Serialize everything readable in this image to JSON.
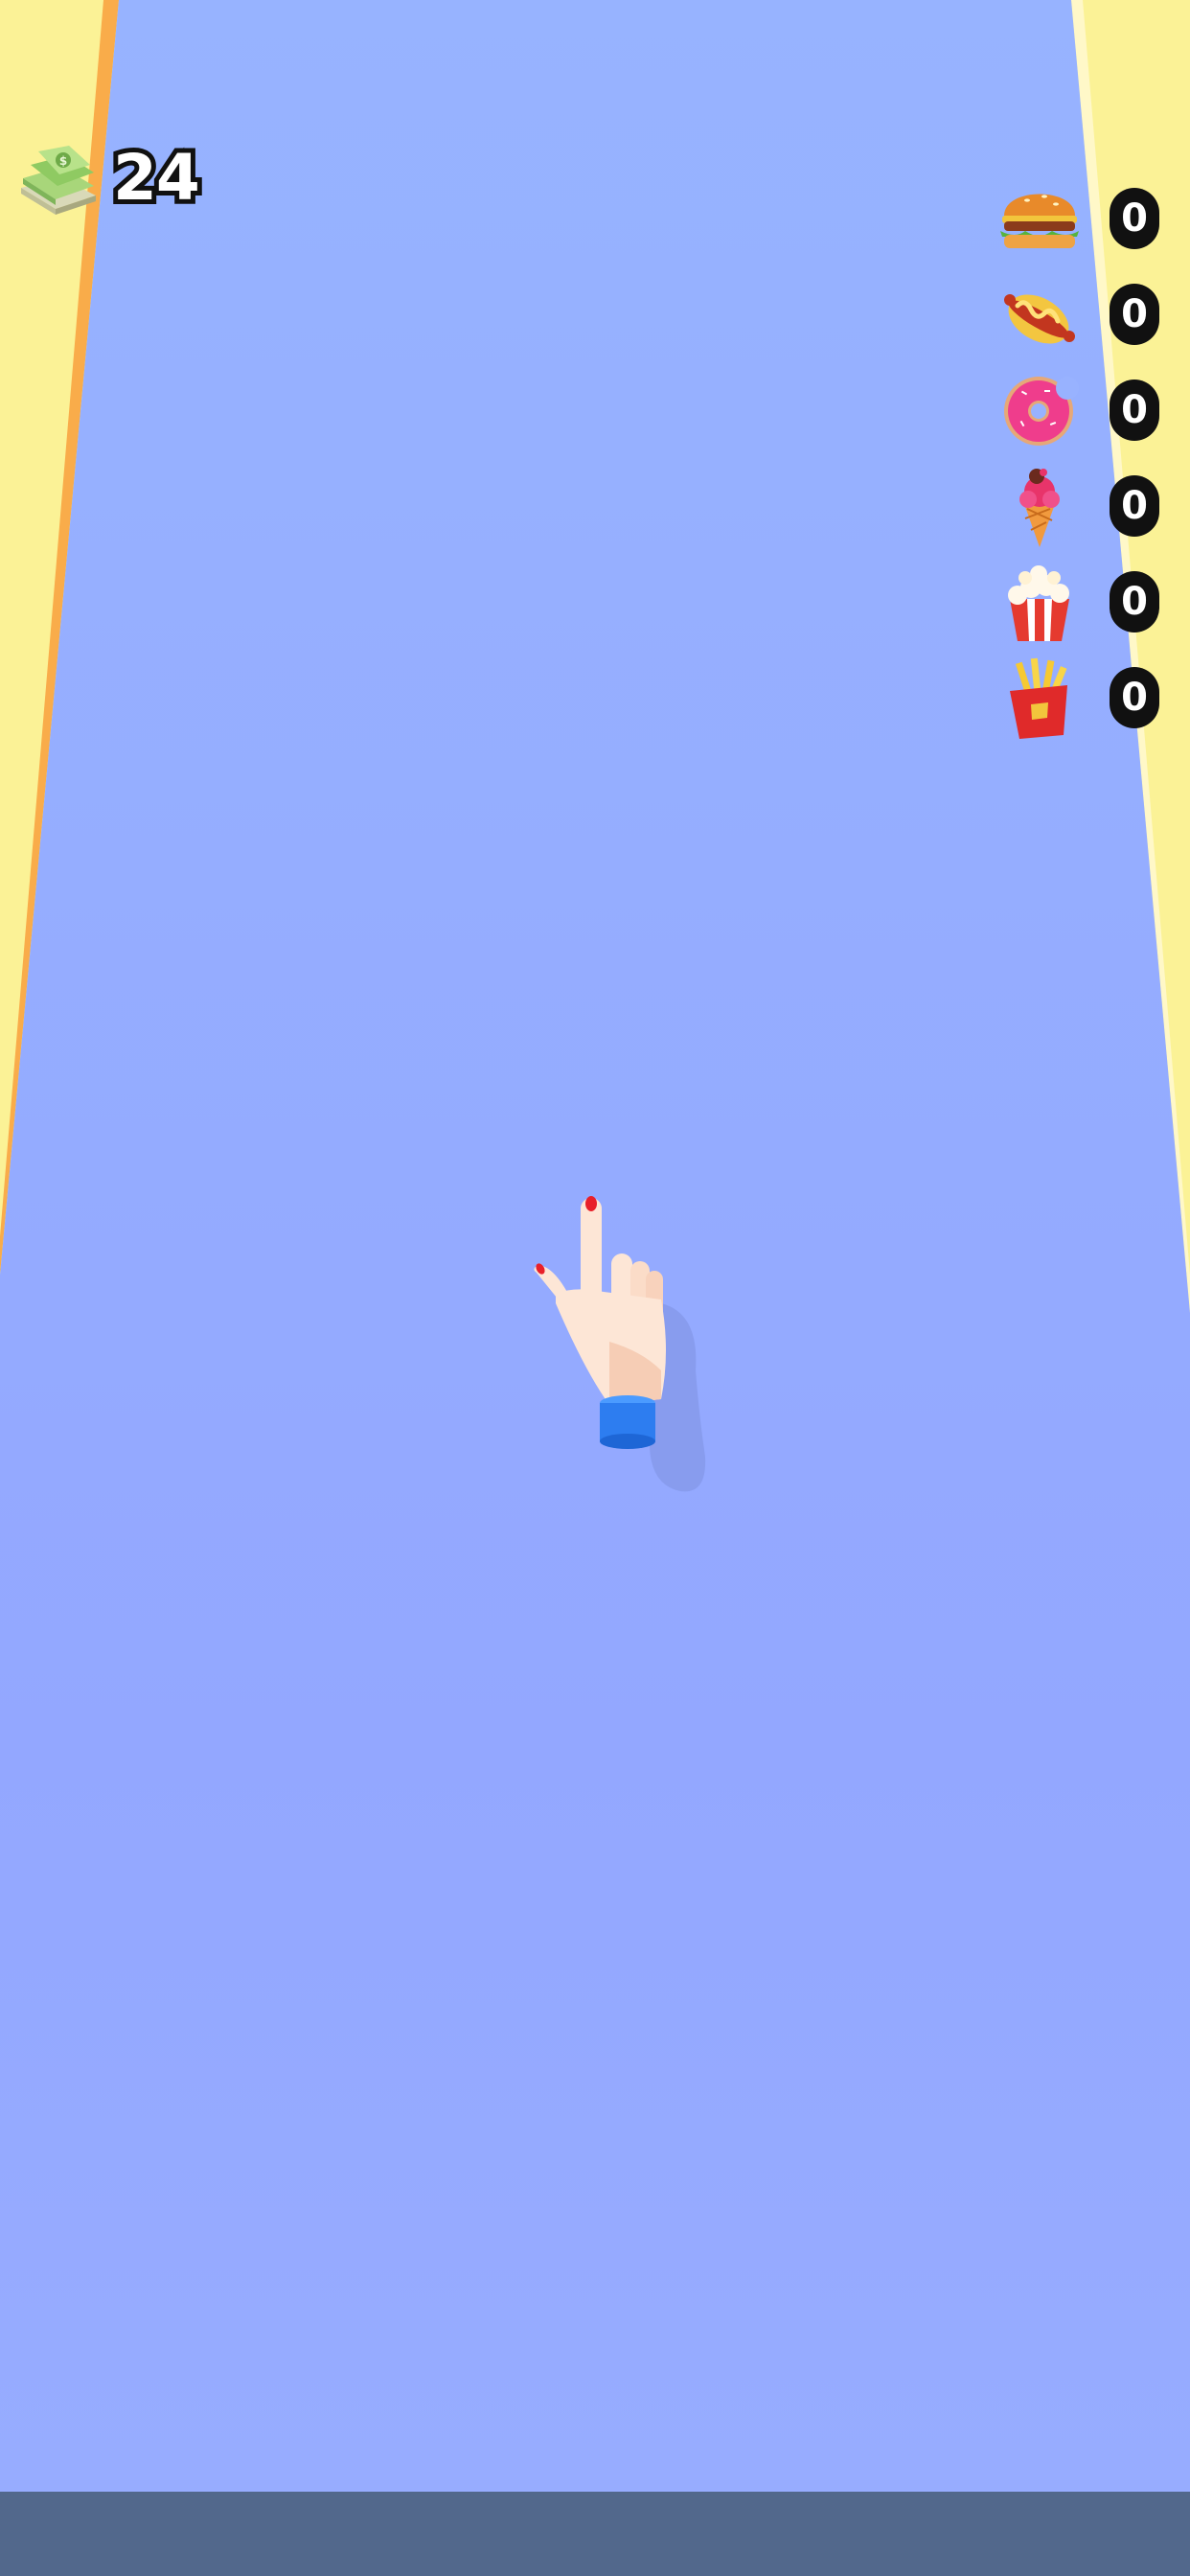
{
  "hud": {
    "money": {
      "icon": "cash-stack-icon",
      "value": "24"
    },
    "food_counters": [
      {
        "icon": "burger-icon",
        "count": "0"
      },
      {
        "icon": "hotdog-icon",
        "count": "0"
      },
      {
        "icon": "donut-icon",
        "count": "0"
      },
      {
        "icon": "ice-cream-cone-icon",
        "count": "0"
      },
      {
        "icon": "popcorn-icon",
        "count": "0"
      },
      {
        "icon": "french-fries-icon",
        "count": "0"
      }
    ]
  },
  "tutorial": {
    "icon": "pointing-hand-icon"
  },
  "colors": {
    "track": "#98b2ff",
    "edge": "#fbf296",
    "edge_line": "#f9ac4a",
    "bottom_bar": "#52688c",
    "cuff": "#2d7df0"
  }
}
